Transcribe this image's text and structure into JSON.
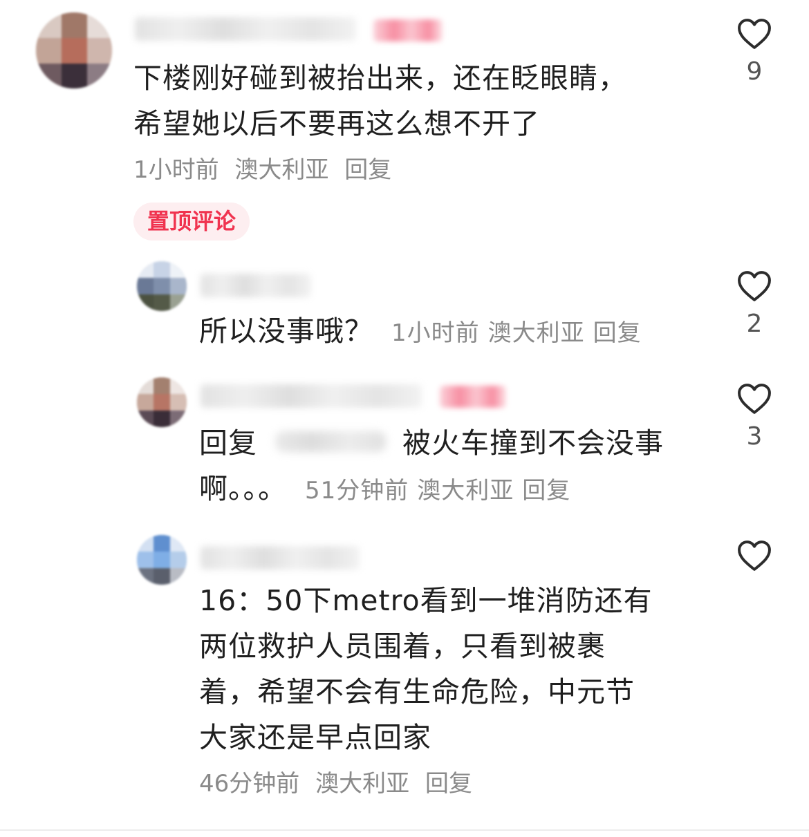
{
  "comments": [
    {
      "text_lines": [
        "下楼刚好碰到被抬出来，还在眨眼睛，",
        "希望她以后不要再这么想不开了"
      ],
      "time": "1小时前",
      "location": "澳大利亚",
      "reply_label": "回复",
      "pin_label": "置顶评论",
      "like_count": "9",
      "like_icon": "heart-outline-icon"
    }
  ],
  "replies": [
    {
      "text": "所以没事哦？",
      "time": "1小时前",
      "location": "澳大利亚",
      "reply_label": "回复",
      "like_count": "2"
    },
    {
      "prefix": "回复",
      "text_line1": "被火车撞到不会没事",
      "text_line2": "啊。。。",
      "time": "51分钟前",
      "location": "澳大利亚",
      "reply_label": "回复",
      "like_count": "3"
    },
    {
      "text_lines": [
        "16：50下metro看到一堆消防还有",
        "两位救护人员围着，只看到被裹",
        "着，希望不会有生命危险，中元节",
        "大家还是早点回家"
      ],
      "time": "46分钟前",
      "location": "澳大利亚",
      "reply_label": "回复",
      "like_count": ""
    }
  ],
  "colors": {
    "pin_text": "#f0334f",
    "pin_bg": "#fdeef0",
    "meta_text": "#8a8a8a",
    "body_text": "#1f1f1f"
  }
}
